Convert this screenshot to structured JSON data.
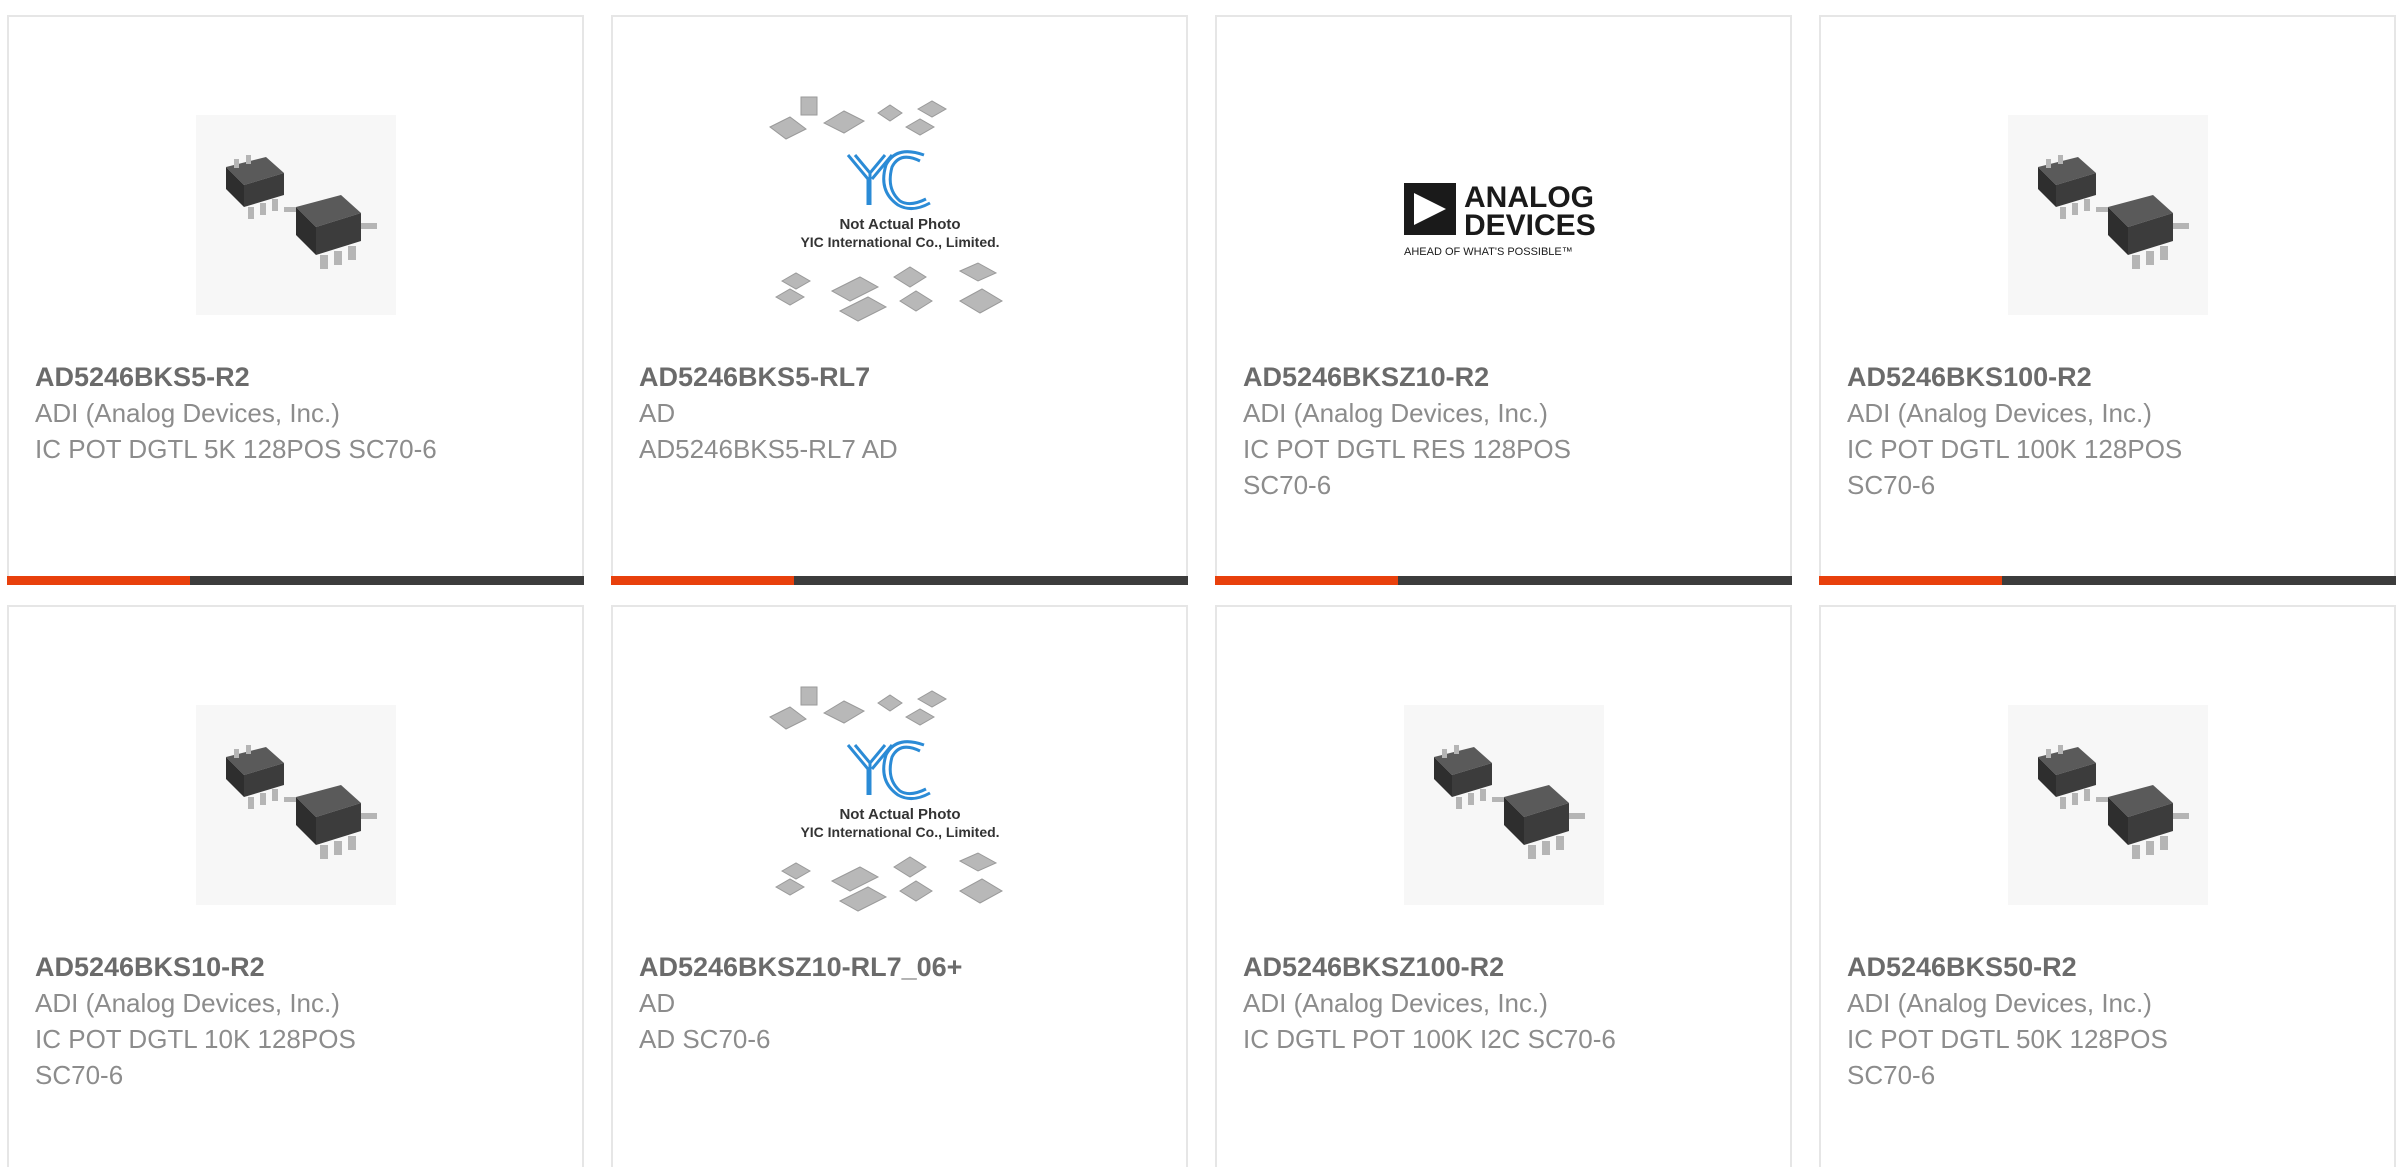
{
  "colors": {
    "accent": "#e8400c",
    "bar_dark": "#3c3c3c",
    "part_number": "#6b6b6b",
    "text": "#8c8c8c",
    "card_border": "#e6e6e6"
  },
  "cards": [
    {
      "part_number": "AD5246BKS5-R2",
      "manufacturer": "ADI (Analog Devices, Inc.)",
      "description": "IC POT DGTL 5K 128POS SC70-6",
      "image": "chip-sc70-photo"
    },
    {
      "part_number": "AD5246BKS5-RL7",
      "manufacturer": "AD",
      "description": "AD5246BKS5-RL7 AD",
      "image": "yic-placeholder",
      "image_caption_line1": "Not Actual Photo",
      "image_caption_line2": "YIC International Co., Limited."
    },
    {
      "part_number": "AD5246BKSZ10-R2",
      "manufacturer": "ADI (Analog Devices, Inc.)",
      "description": "IC POT DGTL RES 128POS SC70-6",
      "image": "analog-devices-logo",
      "logo_line1": "ANALOG",
      "logo_line2": "DEVICES",
      "logo_tagline": "AHEAD OF WHAT'S POSSIBLE™"
    },
    {
      "part_number": "AD5246BKS100-R2",
      "manufacturer": "ADI (Analog Devices, Inc.)",
      "description": "IC POT DGTL 100K 128POS SC70-6",
      "image": "chip-sc70-photo"
    },
    {
      "part_number": "AD5246BKS10-R2",
      "manufacturer": "ADI (Analog Devices, Inc.)",
      "description": "IC POT DGTL 10K 128POS SC70-6",
      "image": "chip-sc70-photo"
    },
    {
      "part_number": "AD5246BKSZ10-RL7_06+",
      "manufacturer": "AD",
      "description": "AD SC70-6",
      "image": "yic-placeholder",
      "image_caption_line1": "Not Actual Photo",
      "image_caption_line2": "YIC International Co., Limited."
    },
    {
      "part_number": "AD5246BKSZ100-R2",
      "manufacturer": "ADI (Analog Devices, Inc.)",
      "description": "IC DGTL POT 100K I2C SC70-6",
      "image": "chip-sc70-photo"
    },
    {
      "part_number": "AD5246BKS50-R2",
      "manufacturer": "ADI (Analog Devices, Inc.)",
      "description": "IC POT DGTL 50K 128POS SC70-6",
      "image": "chip-sc70-photo"
    }
  ]
}
